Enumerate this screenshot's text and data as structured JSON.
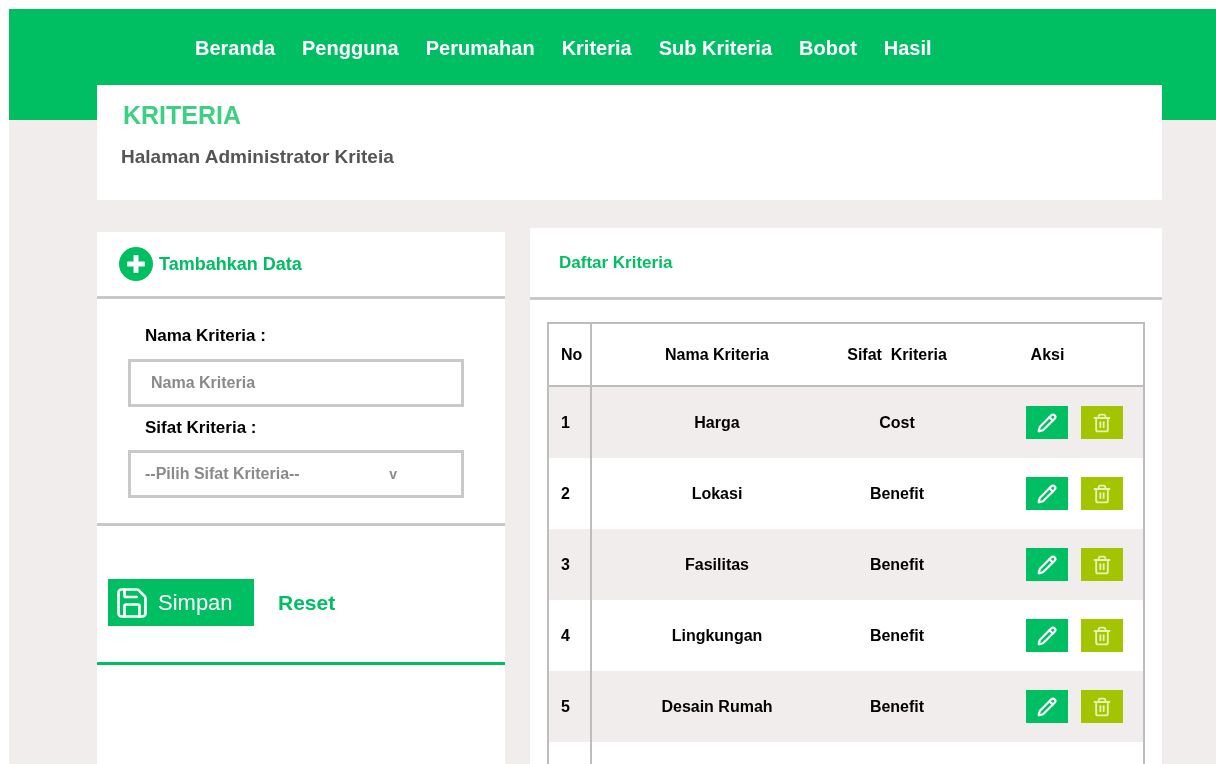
{
  "nav": [
    {
      "label": "Beranda"
    },
    {
      "label": "Pengguna"
    },
    {
      "label": "Perumahan"
    },
    {
      "label": "Kriteria"
    },
    {
      "label": "Sub Kriteria"
    },
    {
      "label": "Bobot"
    },
    {
      "label": "Hasil"
    }
  ],
  "page": {
    "title": "KRITERIA",
    "subtitle": "Halaman Administrator Kriteia"
  },
  "form": {
    "title": "Tambahkan Data",
    "fields": [
      {
        "kind": "text",
        "label": "Nama Kriteria :",
        "placeholder": "Nama Kriteria"
      },
      {
        "kind": "select",
        "label": "Sifat Kriteria :",
        "placeholder": "--Pilih Sifat Kriteria--",
        "caret": "v"
      }
    ],
    "save_button": "Simpan",
    "reset_button": "Reset"
  },
  "list": {
    "title": "Daftar Kriteria",
    "columns": [
      "No",
      "Nama Kriteria",
      "Sifat  Kriteria",
      "Aksi"
    ],
    "rows": [
      {
        "no": "1",
        "name": "Harga",
        "type": "Cost"
      },
      {
        "no": "2",
        "name": "Lokasi",
        "type": "Benefit"
      },
      {
        "no": "3",
        "name": "Fasilitas",
        "type": "Benefit"
      },
      {
        "no": "4",
        "name": "Lingkungan",
        "type": "Benefit"
      },
      {
        "no": "5",
        "name": "Desain Rumah",
        "type": "Benefit"
      }
    ]
  }
}
